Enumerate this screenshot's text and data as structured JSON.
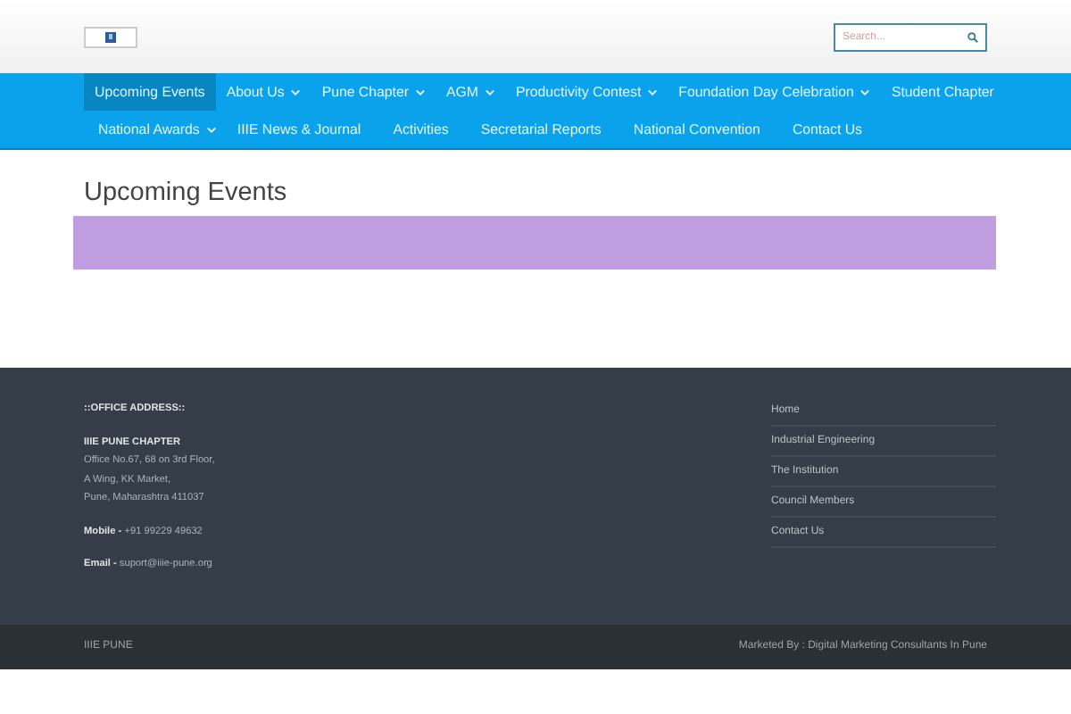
{
  "header": {
    "search": {
      "placeholder": "Search..."
    }
  },
  "nav": [
    {
      "label": "Upcoming Events",
      "selected": true,
      "dropdown": false
    },
    {
      "label": "About Us",
      "selected": false,
      "dropdown": true
    },
    {
      "label": "Pune Chapter",
      "selected": false,
      "dropdown": true
    },
    {
      "label": "AGM",
      "selected": false,
      "dropdown": true
    },
    {
      "label": "Productivity Contest",
      "selected": false,
      "dropdown": true
    },
    {
      "label": "Foundation Day Celebration",
      "selected": false,
      "dropdown": true
    },
    {
      "label": "Student Chapter",
      "selected": false,
      "dropdown": false
    },
    {
      "label": "National Awards",
      "selected": false,
      "dropdown": true
    },
    {
      "label": "IIIE News & Journal",
      "selected": false,
      "dropdown": false
    },
    {
      "label": "Activities",
      "selected": false,
      "dropdown": false
    },
    {
      "label": "Secretarial Reports",
      "selected": false,
      "dropdown": false
    },
    {
      "label": "National Convention",
      "selected": false,
      "dropdown": false
    },
    {
      "label": "Contact Us",
      "selected": false,
      "dropdown": false
    }
  ],
  "page": {
    "title": "Upcoming Events"
  },
  "footer": {
    "heading": "::OFFICE ADDRESS::",
    "address": [
      "IIIE PUNE CHAPTER",
      "Office No.67, 68 on 3rd Floor,",
      "A Wing, KK Market,",
      "Pune, Maharashtra 411037"
    ],
    "mobile": {
      "label": "Mobile -",
      "value": "+91 99229 49632"
    },
    "email": {
      "label": "Email -",
      "value": "suport@iiie-pune.org"
    },
    "links": [
      "Home",
      "Industrial Engineering",
      "The Institution",
      "Council Members",
      "Contact Us"
    ]
  },
  "bottom_bar": {
    "left": "IIIE PUNE",
    "right": "Marketed By : Digital Marketing Consultants In Pune"
  }
}
